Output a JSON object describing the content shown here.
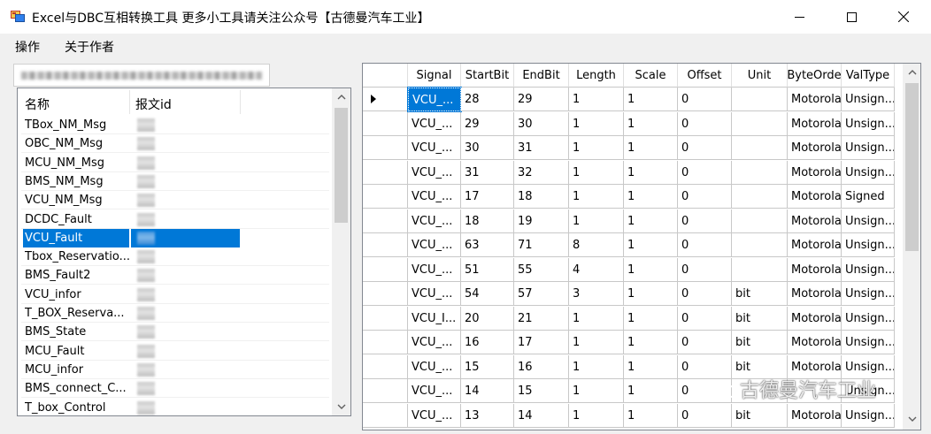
{
  "window": {
    "title": "Excel与DBC互相转换工具  更多小工具请关注公众号【古德曼汽车工业】",
    "icon": "app-window-icon"
  },
  "menu": [
    "操作",
    "关于作者"
  ],
  "message_list": {
    "headers": [
      "名称",
      "报文id"
    ],
    "items": [
      "TBox_NM_Msg",
      "OBC_NM_Msg",
      "MCU_NM_Msg",
      "BMS_NM_Msg",
      "VCU_NM_Msg",
      "DCDC_Fault",
      "VCU_Fault",
      "Tbox_Reservatio...",
      "BMS_Fault2",
      "VCU_infor",
      "T_BOX_Reserva...",
      "BMS_State",
      "MCU_Fault",
      "MCU_infor",
      "BMS_connect_C...",
      "T_box_Control"
    ],
    "selected_index": 6
  },
  "signal_grid": {
    "headers": [
      "Signal",
      "StartBit",
      "EndBit",
      "Length",
      "Scale",
      "Offset",
      "Unit",
      "ByteOrde",
      "ValType"
    ],
    "rows": [
      [
        "VCU_...",
        "28",
        "29",
        "1",
        "1",
        "0",
        "",
        "Motorola",
        "Unsign..."
      ],
      [
        "VCU_...",
        "29",
        "30",
        "1",
        "1",
        "0",
        "",
        "Motorola",
        "Unsign..."
      ],
      [
        "VCU_...",
        "30",
        "31",
        "1",
        "1",
        "0",
        "",
        "Motorola",
        "Unsign..."
      ],
      [
        "VCU_...",
        "31",
        "32",
        "1",
        "1",
        "0",
        "",
        "Motorola",
        "Unsign..."
      ],
      [
        "VCU_...",
        "17",
        "18",
        "1",
        "1",
        "0",
        "",
        "Motorola",
        "Signed"
      ],
      [
        "VCU_...",
        "18",
        "19",
        "1",
        "1",
        "0",
        "",
        "Motorola",
        "Unsign..."
      ],
      [
        "VCU_...",
        "63",
        "71",
        "8",
        "1",
        "0",
        "",
        "Motorola",
        "Unsign..."
      ],
      [
        "VCU_...",
        "51",
        "55",
        "4",
        "1",
        "0",
        "",
        "Motorola",
        "Unsign..."
      ],
      [
        "VCU_...",
        "54",
        "57",
        "3",
        "1",
        "0",
        "bit",
        "Motorola",
        "Unsign..."
      ],
      [
        "VCU_I...",
        "20",
        "21",
        "1",
        "1",
        "0",
        "bit",
        "Motorola",
        "Unsign..."
      ],
      [
        "VCU_...",
        "16",
        "17",
        "1",
        "1",
        "0",
        "bit",
        "Motorola",
        "Unsign..."
      ],
      [
        "VCU_...",
        "15",
        "16",
        "1",
        "1",
        "0",
        "bit",
        "Motorola",
        "Unsign..."
      ],
      [
        "VCU_...",
        "14",
        "15",
        "1",
        "1",
        "0",
        "",
        "",
        "Unsign..."
      ],
      [
        "VCU_...",
        "13",
        "14",
        "1",
        "1",
        "0",
        "bit",
        "Motorola",
        "Unsign..."
      ]
    ],
    "current_row": 0
  },
  "watermark": "古德曼汽车工业",
  "colors": {
    "selection": "#0078d7",
    "chrome": "#f0f0f0"
  }
}
